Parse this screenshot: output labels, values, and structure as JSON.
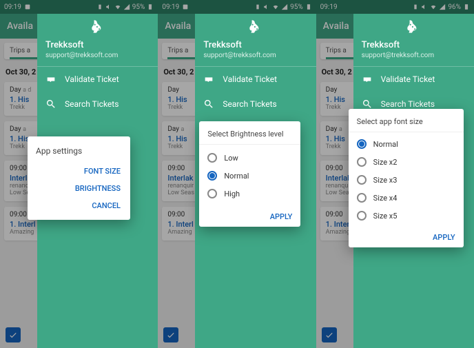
{
  "status": {
    "time": "09:19",
    "battery": "95%",
    "battery3": "96%"
  },
  "appbar": {
    "title_cut": "Availa"
  },
  "tabbar": {
    "label_cut": "Trips a"
  },
  "date": "Oct 30, 2",
  "trips": {
    "day_label": "Day",
    "day_sub": "a d",
    "his_title": "1. His",
    "his_meta": "Trekk",
    "time1": "09:00",
    "interlak_title": "Interlak",
    "interlak_meta1": "renanquir",
    "interlak_meta2": "Low Seas",
    "interl_title": "1. Interl",
    "interl_meta": "Amazing"
  },
  "drawer": {
    "brand": "Trekksoft",
    "email": "support@trekksoft.com",
    "validate": "Validate Ticket",
    "search": "Search Tickets"
  },
  "dlg1": {
    "title": "App settings",
    "font": "FONT SIZE",
    "brightness": "BRIGHTNESS",
    "cancel": "CANCEL"
  },
  "dlg2": {
    "title": "Select Brightness level",
    "low": "Low",
    "normal": "Normal",
    "high": "High",
    "apply": "APPLY"
  },
  "dlg3": {
    "title": "Select app font size",
    "o1": "Normal",
    "o2": "Size x2",
    "o3": "Size x3",
    "o4": "Size x4",
    "o5": "Size x5",
    "apply": "APPLY"
  }
}
